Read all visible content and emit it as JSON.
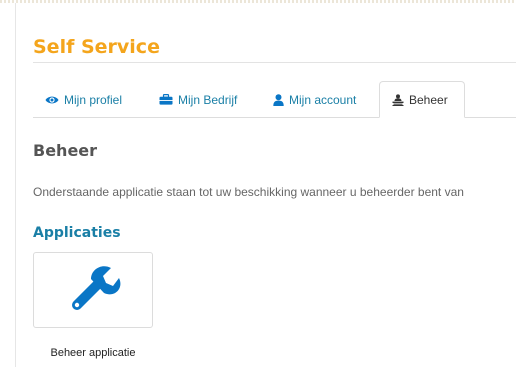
{
  "header": {
    "title": "Self Service"
  },
  "tabs": [
    {
      "label": "Mijn profiel",
      "icon": "eye-icon",
      "active": false
    },
    {
      "label": "Mijn Bedrijf",
      "icon": "briefcase-icon",
      "active": false
    },
    {
      "label": "Mijn account",
      "icon": "user-icon",
      "active": false
    },
    {
      "label": "Beheer",
      "icon": "admin-icon",
      "active": true
    }
  ],
  "main": {
    "section_title": "Beheer",
    "description": "Onderstaande applicatie staan tot uw beschikking wanneer u beheerder bent van",
    "subsection_title": "Applicaties",
    "apps": [
      {
        "label": "Beheer applicatie",
        "icon": "wrench-icon"
      }
    ]
  },
  "colors": {
    "brand_orange": "#f4a51c",
    "link_blue": "#1a7fa6",
    "icon_blue": "#0a76c6"
  }
}
